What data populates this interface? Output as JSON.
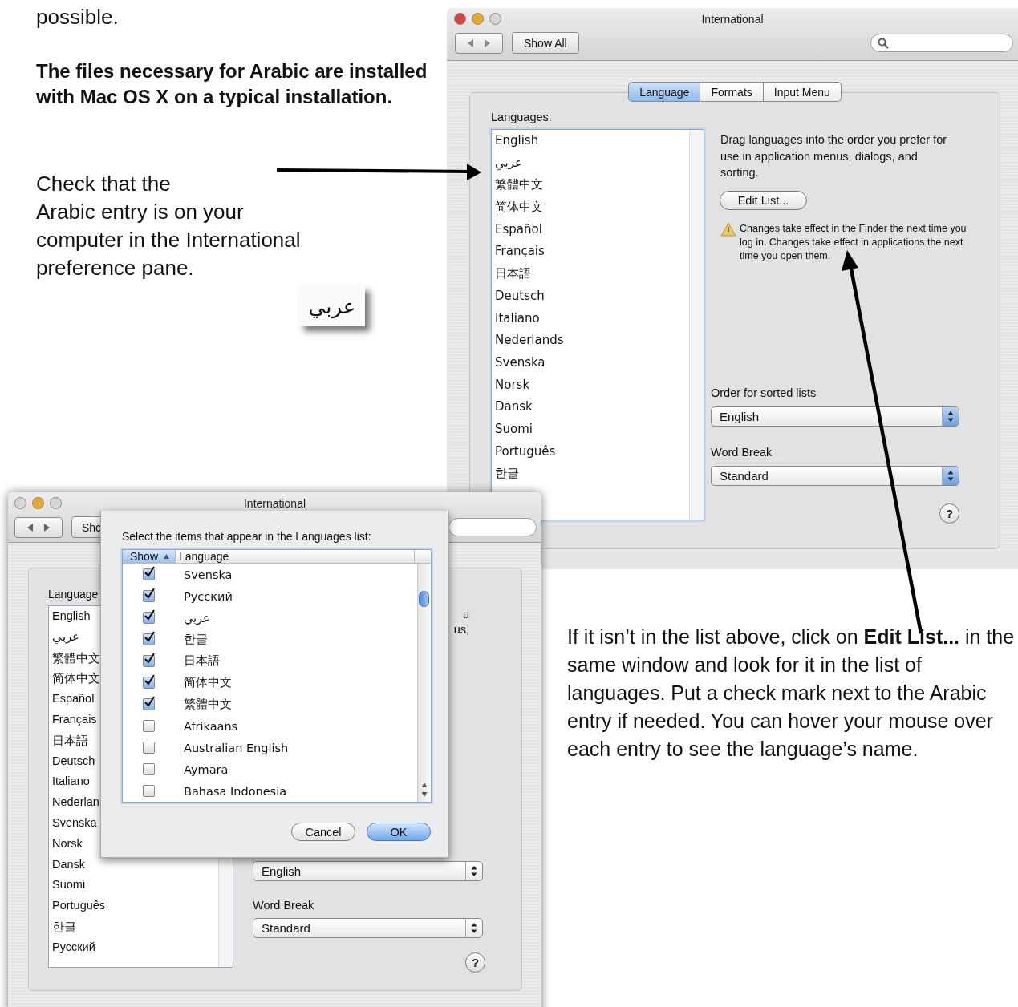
{
  "page": {
    "intro_end": "possible.",
    "bold_note": "The files necessary for Arabic are installed with Mac OS X on a typical installation.",
    "check_note": "Check that the\nArabic entry is on your\ncomputer in the International\npreference pane.",
    "arabic_sample": "عربي",
    "edit_note": "If it isn’t in the list above, click on **Edit List...** in the same window and look for it in the list of languages.  Put a check mark next to the Arabic entry if needed.  You can hover your mouse over each entry to see the language’s name."
  },
  "preferences_window": {
    "title": "International",
    "window_buttons": [
      {
        "color": "#d8443a"
      },
      {
        "color": "#e8a92a"
      },
      {
        "color": "#d6d6d6"
      }
    ],
    "show_all": "Show All",
    "tabs": [
      {
        "label": "Language",
        "selected": true
      },
      {
        "label": "Formats",
        "selected": false
      },
      {
        "label": "Input Menu",
        "selected": false
      }
    ],
    "languages_label": "Languages:",
    "languages": [
      "English",
      "عربي",
      "繁體中文",
      "简体中文",
      "Español",
      "Français",
      "日本語",
      "Deutsch",
      "Italiano",
      "Nederlands",
      "Svenska",
      "Norsk",
      "Dansk",
      "Suomi",
      "Português",
      "한글"
    ],
    "instructions": "Drag languages into the order you prefer for use in application menus, dialogs, and sorting.",
    "edit_list_button": "Edit List...",
    "warning": "Changes take effect in the Finder the next time you log in. Changes take effect in applications the next time you open them.",
    "sorted_label": "Order for sorted lists",
    "sorted_value": "English",
    "word_break_label": "Word Break",
    "word_break_value": "Standard",
    "help": "?"
  },
  "edit_window": {
    "title": "International",
    "window_buttons": [
      {
        "color": "#d6d6d6"
      },
      {
        "color": "#e8a92a"
      },
      {
        "color": "#d6d6d6"
      }
    ],
    "show_all": "Sho",
    "languages_label": "Language",
    "languages": [
      "English",
      "عربي",
      "繁體中文",
      "简体中文",
      "Español",
      "Français",
      "日本語",
      "Deutsch",
      "Italiano",
      "Nederlan",
      "Svenska",
      "Norsk",
      "Dansk",
      "Suomi",
      "Português",
      "한글",
      "Русский"
    ],
    "fragments": [
      "u",
      "us,"
    ],
    "sorted_value": "English",
    "word_break_label": "Word Break",
    "word_break_value": "Standard",
    "help": "?",
    "sheet": {
      "prompt": "Select the items that appear in the Languages list:",
      "columns": [
        {
          "label": "Show",
          "sorted": true
        },
        {
          "label": "Language",
          "sorted": false
        }
      ],
      "rows": [
        {
          "label": "Svenska",
          "checked": true
        },
        {
          "label": "Русский",
          "checked": true
        },
        {
          "label": "عربي",
          "checked": true
        },
        {
          "label": "한글",
          "checked": true
        },
        {
          "label": "日本語",
          "checked": true
        },
        {
          "label": "简体中文",
          "checked": true
        },
        {
          "label": "繁體中文",
          "checked": true
        },
        {
          "label": "Afrikaans",
          "checked": false
        },
        {
          "label": "Australian English",
          "checked": false
        },
        {
          "label": "Aymara",
          "checked": false
        },
        {
          "label": "Bahasa Indonesia",
          "checked": false
        }
      ],
      "buttons": [
        {
          "label": "Cancel",
          "default": false
        },
        {
          "label": "OK",
          "default": true
        }
      ]
    }
  }
}
